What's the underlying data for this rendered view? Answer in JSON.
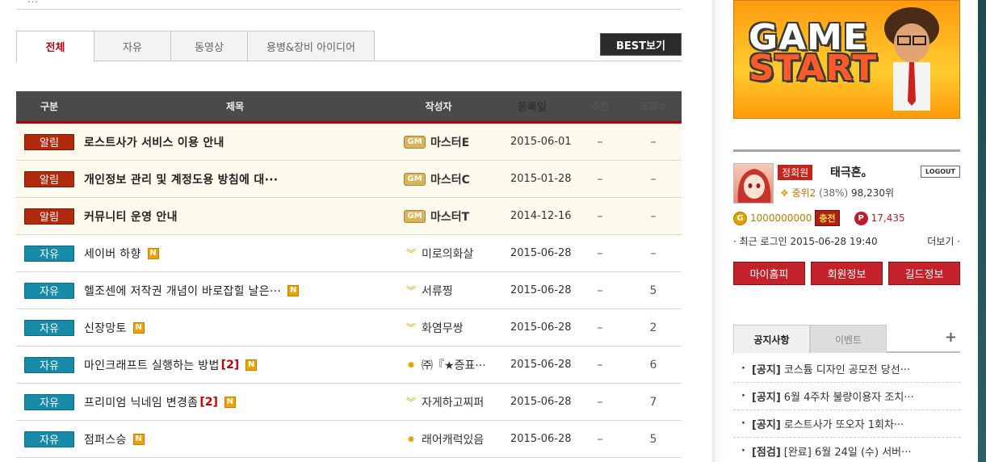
{
  "top_strip": {
    "ghost_text": "…"
  },
  "tabs": [
    {
      "label": "전체",
      "active": true
    },
    {
      "label": "자유",
      "active": false
    },
    {
      "label": "동영상",
      "active": false
    },
    {
      "label": "용병&장비 아이디어",
      "active": false
    }
  ],
  "best_button": "BEST보기",
  "table": {
    "headers": {
      "category": "구분",
      "title": "제목",
      "author": "작성자",
      "date": "등록일",
      "recommend": "추천",
      "views": "조회수"
    },
    "rows": [
      {
        "category": "알림",
        "type": "notice",
        "title": "로스트사가 서비스 이용 안내",
        "reply": "",
        "new": false,
        "rank": "gm",
        "rank_text": "GM",
        "author": "마스터E",
        "date": "2015-06-01",
        "recommend": "–",
        "views": "–"
      },
      {
        "category": "알림",
        "type": "notice",
        "title": "개인정보 관리 및 계정도용 방침에 대···",
        "reply": "",
        "new": false,
        "rank": "gm",
        "rank_text": "GM",
        "author": "마스터C",
        "date": "2015-01-28",
        "recommend": "–",
        "views": "–"
      },
      {
        "category": "알림",
        "type": "notice",
        "title": "커뮤니티 운영 안내",
        "reply": "",
        "new": false,
        "rank": "gm",
        "rank_text": "GM",
        "author": "마스터T",
        "date": "2014-12-16",
        "recommend": "–",
        "views": "–"
      },
      {
        "category": "자유",
        "type": "free",
        "title": "세이버 하향",
        "reply": "",
        "new": true,
        "rank": "wing",
        "rank_text": "",
        "author": "미로의화살",
        "date": "2015-06-28",
        "recommend": "–",
        "views": "–"
      },
      {
        "category": "자유",
        "type": "free",
        "title": "헬조센에 저작권 개념이 바로잡힐 날은···",
        "reply": "",
        "new": true,
        "rank": "wing",
        "rank_text": "",
        "author": "서류찡",
        "date": "2015-06-28",
        "recommend": "–",
        "views": "5"
      },
      {
        "category": "자유",
        "type": "free",
        "title": "신장망토",
        "reply": "",
        "new": true,
        "rank": "wing",
        "rank_text": "",
        "author": "화염무쌍",
        "date": "2015-06-28",
        "recommend": "–",
        "views": "2"
      },
      {
        "category": "자유",
        "type": "free",
        "title": "마인크래프트 실행하는 방법",
        "reply": "[2]",
        "new": true,
        "rank": "star",
        "rank_text": "",
        "author": "㈜『★증표···",
        "date": "2015-06-28",
        "recommend": "–",
        "views": "6"
      },
      {
        "category": "자유",
        "type": "free",
        "title": "프리미엄 닉네임 변경좀",
        "reply": "[2]",
        "new": true,
        "rank": "wing",
        "rank_text": "",
        "author": "자게하고찌퍼",
        "date": "2015-06-28",
        "recommend": "–",
        "views": "7"
      },
      {
        "category": "자유",
        "type": "free",
        "title": "점퍼스승",
        "reply": "",
        "new": true,
        "rank": "star",
        "rank_text": "",
        "author": "래어캐럭있음",
        "date": "2015-06-28",
        "recommend": "–",
        "views": "5"
      }
    ],
    "new_icon_text": "N"
  },
  "game_start": {
    "line1": "GAME",
    "line2": "START"
  },
  "user": {
    "member_badge": "정회원",
    "nickname": "태극혼。",
    "logout_label": "LOGOUT",
    "level": "중위2",
    "level_pct": "(38%)",
    "rank_pos": "98,230위",
    "gold_symbol": "G",
    "gold": "1000000000",
    "charge_label": "충전",
    "point_symbol": "P",
    "points": "17,435",
    "last_login_label": "· 최근 로그인 2015-06-28 19:40",
    "more_label": "더보기 ·",
    "buttons": [
      "마이홈피",
      "회원정보",
      "길드정보"
    ]
  },
  "notice_panel": {
    "tabs": [
      "공지사항",
      "이벤트"
    ],
    "plus": "+",
    "items": [
      {
        "tag": "[공지]",
        "text": "코스튬 디자인 공모전 당선···"
      },
      {
        "tag": "[공지]",
        "text": "6월 4주차 불량이용자 조치···"
      },
      {
        "tag": "[공지]",
        "text": "로스트사가 또오자 1회차···"
      },
      {
        "tag": "[점검]",
        "text": "[완료] 6월 24일 (수) 서버···"
      }
    ]
  },
  "colors": {
    "accent_red": "#c9000b",
    "notice_badge": "#b22a0e",
    "free_badge": "#168aa6",
    "header_bg": "#4a4a4a"
  }
}
